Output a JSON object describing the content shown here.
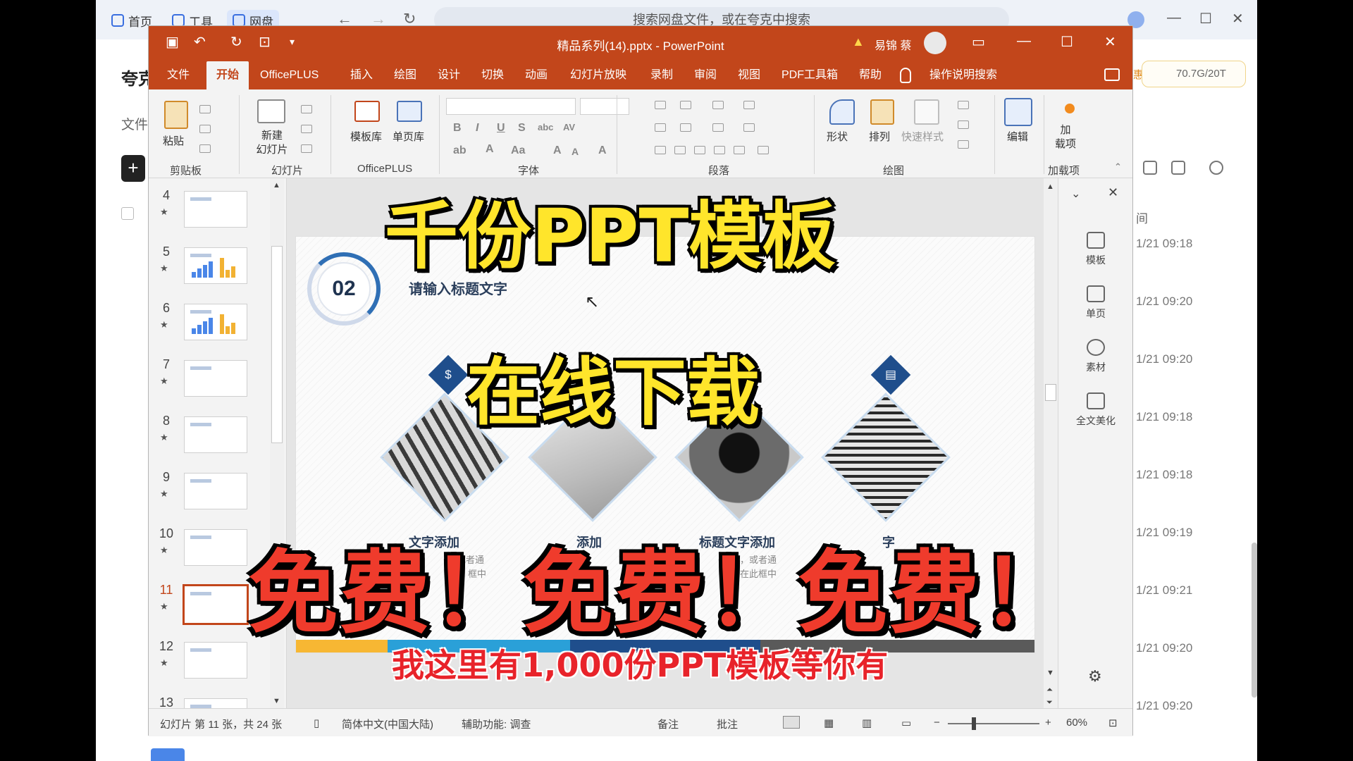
{
  "drive": {
    "tabs": [
      "首页",
      "工具",
      "网盘"
    ],
    "search_placeholder": "搜索网盘文件，或在夸克中搜索",
    "left_title": "夸克",
    "left_file": "文件",
    "storage": "70.7G/20T",
    "storage_prefix": "惠",
    "time_col": "间",
    "times": [
      "1/21 09:18",
      "1/21 09:20",
      "1/21 09:20",
      "1/21 09:18",
      "1/21 09:18",
      "1/21 09:19",
      "1/21 09:21",
      "1/21 09:20",
      "1/21 09:20"
    ]
  },
  "ppt": {
    "title": "精品系列(14).pptx  -  PowerPoint",
    "user": "易锦 蔡",
    "menu": [
      "文件",
      "开始",
      "OfficePLUS",
      "插入",
      "绘图",
      "设计",
      "切换",
      "动画",
      "幻灯片放映",
      "录制",
      "审阅",
      "视图",
      "PDF工具箱",
      "帮助",
      "操作说明搜索"
    ],
    "active_menu": "开始",
    "ribbon": {
      "paste": "粘贴",
      "new_slide": "新建\n幻灯片",
      "template_lib": "模板库",
      "single_lib": "单页库",
      "shape": "形状",
      "arrange": "排列",
      "quick_style": "快速样式",
      "edit": "编辑",
      "addin": "加\n载项",
      "groups": [
        "剪贴板",
        "幻灯片",
        "OfficePLUS",
        "字体",
        "段落",
        "绘图",
        "加载项"
      ]
    },
    "thumbnails": [
      {
        "num": "4"
      },
      {
        "num": "5"
      },
      {
        "num": "6"
      },
      {
        "num": "7"
      },
      {
        "num": "8"
      },
      {
        "num": "9"
      },
      {
        "num": "10"
      },
      {
        "num": "11"
      },
      {
        "num": "12"
      },
      {
        "num": "13"
      }
    ],
    "selected_slide": "11",
    "slide": {
      "number": "02",
      "title": "请输入标题文字",
      "subtitles": [
        "文字添加",
        "添加",
        "标题文字添加",
        "字"
      ],
      "body_lines": [
        "或者通",
        "框中",
        "，或者通",
        "在此框中"
      ]
    },
    "designer": [
      "模板",
      "单页",
      "素材",
      "全文美化"
    ],
    "status": {
      "slide_info": "幻灯片 第 11 张，共 24 张",
      "language": "简体中文(中国大陆)",
      "accessibility": "辅助功能: 调查",
      "notes": "备注",
      "comments": "批注",
      "zoom": "60%"
    }
  },
  "overlay": {
    "line1": "千份PPT模板",
    "line2": "在线下载",
    "line3": "免费！免费！免费！",
    "line4": "我这里有1,000份PPT模板等你有"
  },
  "colors": {
    "ppt_accent": "#c2461b",
    "caption_yellow": "#ffe52b",
    "caption_red": "#ef3b2c"
  }
}
